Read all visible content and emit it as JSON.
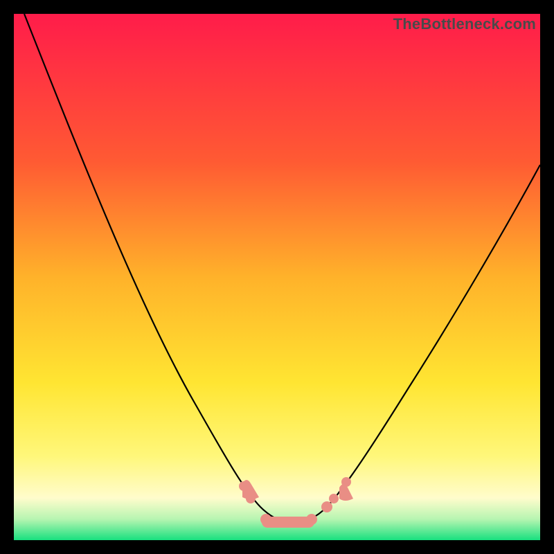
{
  "watermark": "TheBottleneck.com",
  "colors": {
    "bg_black": "#000000",
    "grad_top": "#ff1c4a",
    "grad_mid1": "#ff8c2a",
    "grad_mid2": "#ffe532",
    "grad_low": "#fff9b0",
    "grad_bottom": "#18e07f",
    "curve": "#000000",
    "marker": "#e98e85",
    "watermark": "#4a4a4a"
  },
  "chart_data": {
    "type": "line",
    "title": "",
    "xlabel": "",
    "ylabel": "",
    "xlim": [
      0,
      100
    ],
    "ylim": [
      0,
      100
    ],
    "grid": false,
    "legend": false,
    "x": [
      2,
      10,
      20,
      30,
      38,
      44,
      48,
      50,
      52,
      54,
      56,
      58,
      62,
      68,
      78,
      90,
      100
    ],
    "values": [
      100,
      82,
      60,
      40,
      24,
      12,
      4,
      1,
      0,
      0,
      1,
      4,
      12,
      24,
      42,
      60,
      72
    ],
    "markers_x": [
      44,
      48,
      50,
      52,
      54,
      56,
      58,
      62
    ],
    "markers_y": [
      12,
      4,
      1,
      0,
      0,
      1,
      4,
      12
    ],
    "notes": "Asymmetric V-shaped bottleneck curve; minimum ~0 near x≈52–54; left branch starts at top-left corner (y≈100), right branch exits at ~y≈72 on the right edge. Salmon-pink rounded markers cluster around the trough."
  }
}
